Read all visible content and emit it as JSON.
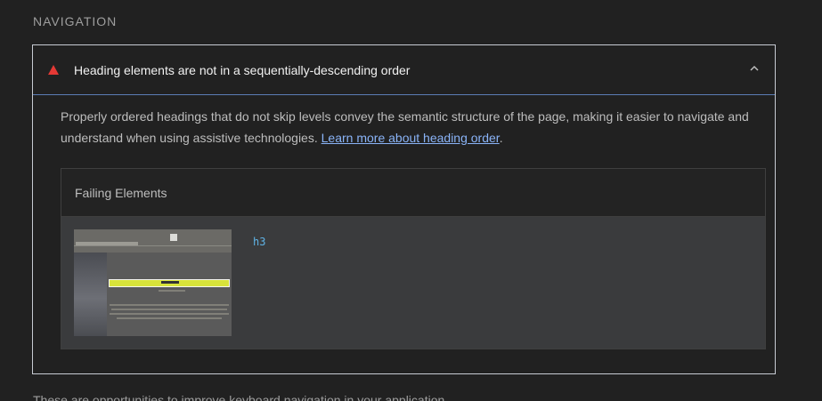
{
  "section": {
    "title": "NAVIGATION"
  },
  "audit": {
    "title": "Heading elements are not in a sequentially-descending order",
    "status_icon": "warning-triangle-icon",
    "status_color": "#e53935",
    "expanded": true,
    "description_text": "Properly ordered headings that do not skip levels convey the semantic structure of the page, making it easier to navigate and understand when using assistive technologies. ",
    "learn_more_label": "Learn more about heading order",
    "description_end": ".",
    "table": {
      "header": "Failing Elements",
      "rows": [
        {
          "element": "h3"
        }
      ]
    }
  },
  "footer": {
    "text": "These are opportunities to improve keyboard navigation in your application."
  },
  "colors": {
    "background": "#212121",
    "accent_link": "#8ab4f8",
    "code": "#5fb3e6",
    "focus_border": "#5c7db6"
  }
}
